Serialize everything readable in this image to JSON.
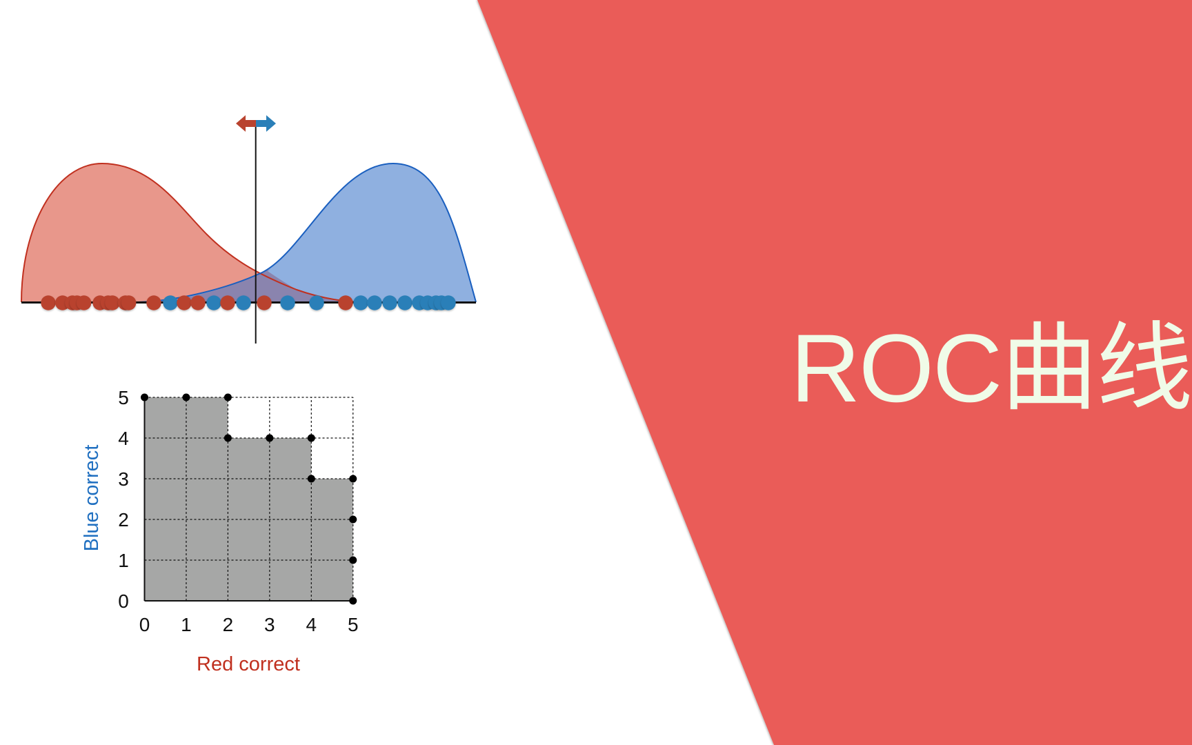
{
  "slide": {
    "title": "ROC曲线",
    "colors": {
      "background_panel": "#ea5c58",
      "title_text": "#f0fbe8",
      "red_class": "#c0301f",
      "red_fill": "#e8978b",
      "red_dot": "#b9432f",
      "blue_class": "#1a5fbf",
      "blue_fill": "#8fb0e0",
      "blue_dot": "#2a7fb8",
      "grid_fill": "#a6a7a6"
    }
  },
  "distribution_diagram": {
    "threshold_arrow": {
      "left_icon": "arrow-left-icon",
      "right_icon": "arrow-right-icon"
    },
    "red_points": [
      70,
      90.7,
      105,
      111.7,
      121.7,
      145,
      156.7,
      163,
      181.7,
      186.7,
      223,
      267,
      287,
      330,
      383,
      501
    ],
    "blue_points": [
      247,
      310,
      353,
      417,
      459,
      523,
      543,
      565,
      587,
      608,
      620,
      632,
      640,
      650
    ],
    "threshold_position": 370.7
  },
  "chart_data": {
    "type": "area",
    "title": "",
    "xlabel": "Red correct",
    "ylabel": "Blue correct",
    "x_ticks": [
      "0",
      "1",
      "2",
      "3",
      "4",
      "5"
    ],
    "y_ticks": [
      "0",
      "1",
      "2",
      "3",
      "4",
      "5"
    ],
    "xlim": [
      0,
      5
    ],
    "ylim": [
      0,
      5
    ],
    "grid": true,
    "points": [
      {
        "x": 0,
        "y": 5
      },
      {
        "x": 1,
        "y": 5
      },
      {
        "x": 2,
        "y": 5
      },
      {
        "x": 2,
        "y": 4
      },
      {
        "x": 3,
        "y": 4
      },
      {
        "x": 4,
        "y": 4
      },
      {
        "x": 4,
        "y": 3
      },
      {
        "x": 5,
        "y": 3
      },
      {
        "x": 5,
        "y": 2
      },
      {
        "x": 5,
        "y": 1
      },
      {
        "x": 5,
        "y": 0
      }
    ]
  }
}
